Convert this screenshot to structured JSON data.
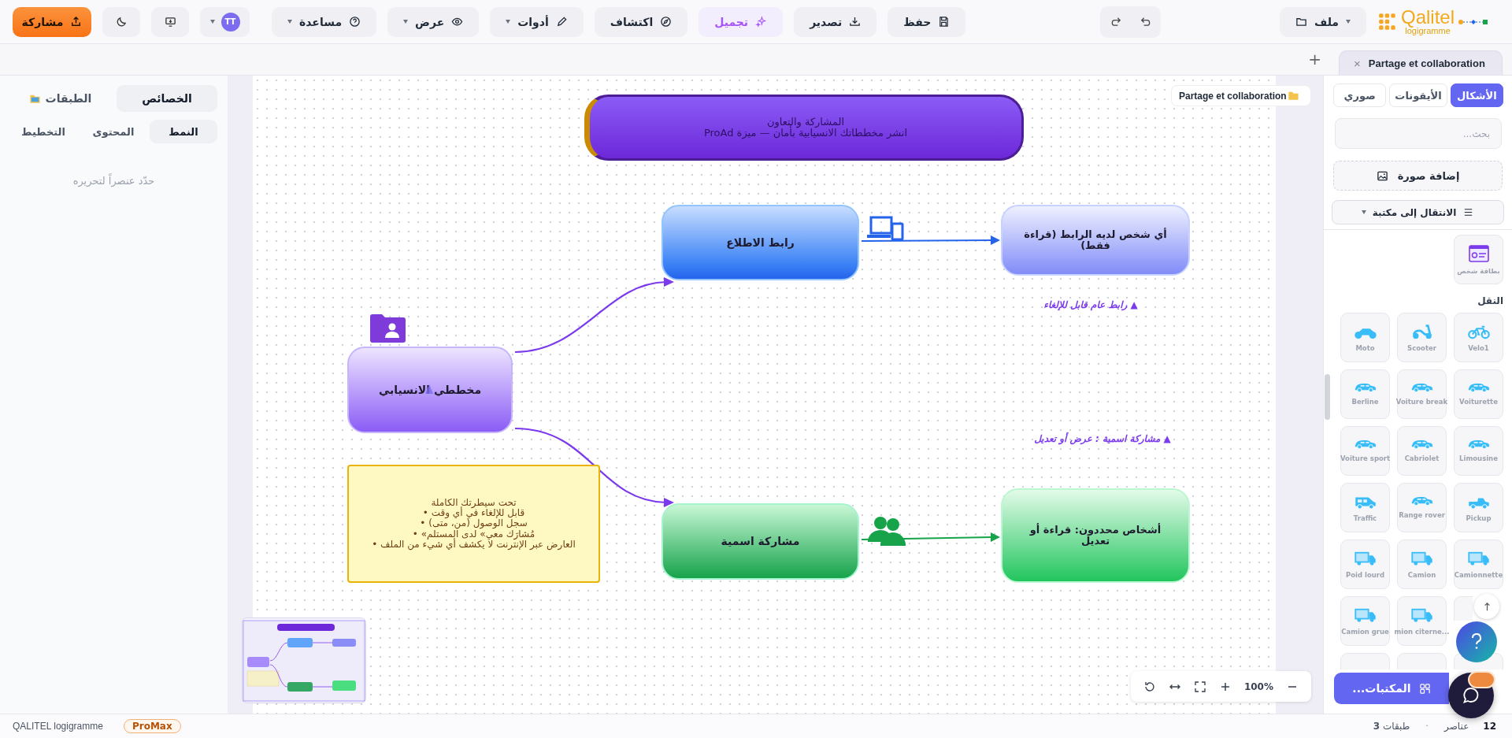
{
  "header": {
    "logo": {
      "name": "Qalitel",
      "tagline": "logigramme"
    },
    "share_button": "مشاركة",
    "avatar": "TT",
    "actions": [
      {
        "label": "حفظ",
        "highlighted": false
      },
      {
        "label": "تصدير",
        "highlighted": false
      },
      {
        "label": "تجميل",
        "highlighted": true
      },
      {
        "label": "اكتشاف",
        "highlighted": false
      }
    ],
    "menus": [
      {
        "label": "أدوات"
      },
      {
        "label": "عرض"
      },
      {
        "label": "مساعدة"
      }
    ],
    "file_menu": "ملف"
  },
  "document_tabs": [
    {
      "label": "Partage et collaboration",
      "selected": true,
      "close": "×"
    }
  ],
  "new_tab": "+",
  "left_panel": {
    "tabs": [
      {
        "label": "الخصائص",
        "selected": true
      },
      {
        "label": "الطبقات",
        "selected": false
      }
    ],
    "subtabs": [
      {
        "label": "النمط",
        "selected": true
      },
      {
        "label": "المحتوى",
        "selected": false
      },
      {
        "label": "التخطيط",
        "selected": false
      }
    ],
    "empty_message": "حدّد عنصراً لتحريره"
  },
  "canvas": {
    "badge": "Partage et collaboration",
    "title": {
      "heading": "المشاركة والتعاون",
      "subtitle": "انشر مخططاتك الانسيابية بأمان — ميزة ProAd"
    },
    "nodes": [
      {
        "kind": "link_target",
        "label": "أي شخص لديه الرابط (قراءة فقط)"
      },
      {
        "kind": "link",
        "label": "رابط الاطلاع"
      },
      {
        "kind": "source",
        "label": "مخططي الانسيابي"
      },
      {
        "kind": "named_target",
        "label": "أشخاص محددون: قراءة أو تعديل"
      },
      {
        "kind": "named",
        "label": "مشاركة اسمية"
      }
    ],
    "labels": [
      "▲ رابط عام قابل للإلغاء",
      "▲ مشاركة اسمية : عرض أو تعديل"
    ],
    "note": [
      "تحت سيطرتك الكاملة",
      "• قابل للإلغاء في أي وقت",
      "• سجل الوصول (من، متى)",
      "• «مُشارَك معي» لدى المستلم",
      "• العارض عبر الإنترنت لا يكشف أي شيء من الملف"
    ],
    "zoom": "100%"
  },
  "right_panel": {
    "tabs": [
      {
        "label": "الأشكال",
        "selected": true
      },
      {
        "label": "الأيقونات",
        "selected": false
      },
      {
        "label": "صوري",
        "selected": false
      }
    ],
    "search": {
      "placeholder": "بحث..."
    },
    "add_image": "إضافة صورة",
    "library_select": "الانتقال إلى مكتبة",
    "person_card": "بطاقة شخص",
    "section": "النقل",
    "shapes": [
      {
        "label": "Velo1"
      },
      {
        "label": "Scooter"
      },
      {
        "label": "Moto"
      },
      {
        "label": "Voiturette"
      },
      {
        "label": "Voiture break"
      },
      {
        "label": "Berline"
      },
      {
        "label": "Limousine"
      },
      {
        "label": "Cabriolet"
      },
      {
        "label": "Voiture sport"
      },
      {
        "label": "Pickup"
      },
      {
        "label": "Range rover"
      },
      {
        "label": "Traffic"
      },
      {
        "label": "Camionnette"
      },
      {
        "label": "Camion"
      },
      {
        "label": "Poid lourd"
      },
      {
        "label": "...mion citerne"
      },
      {
        "label": "Camion grue"
      }
    ],
    "libraries_button": "المكتبات..."
  },
  "status_bar": {
    "app": "QALITEL logigramme",
    "plan": "ProMax",
    "elements_count": "12",
    "elements_label": "عناصر",
    "separator": "·",
    "layers": "**3** طبقات"
  }
}
